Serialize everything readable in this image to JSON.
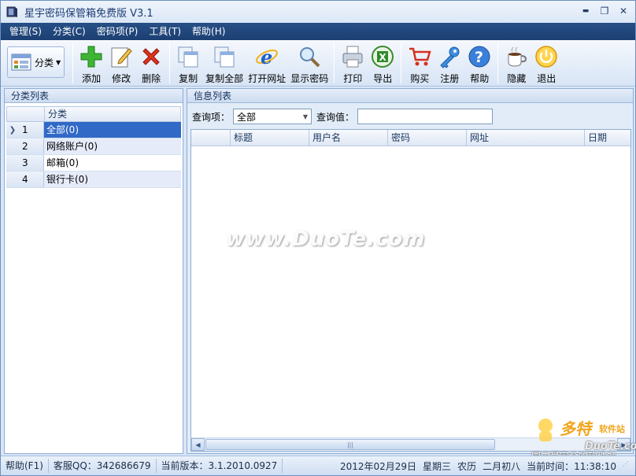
{
  "window": {
    "title": "星宇密码保管箱免费版 V3.1",
    "minimize_label": "▬",
    "maximize_label": "❐",
    "close_label": "✕"
  },
  "menu": [
    {
      "label": "管理(S)"
    },
    {
      "label": "分类(C)"
    },
    {
      "label": "密码项(P)"
    },
    {
      "label": "工具(T)"
    },
    {
      "label": "帮助(H)"
    }
  ],
  "toolbar": {
    "category_label": "分类",
    "buttons": {
      "add": "添加",
      "edit": "修改",
      "delete": "删除",
      "copy": "复制",
      "copy_all": "复制全部",
      "open_url": "打开网址",
      "show_password": "显示密码",
      "print": "打印",
      "export": "导出",
      "buy": "购买",
      "register": "注册",
      "help": "帮助",
      "hide": "隐藏",
      "exit": "退出"
    }
  },
  "left_panel": {
    "title": "分类列表",
    "column": "分类",
    "rows": [
      {
        "num": "1",
        "name": "全部(0)"
      },
      {
        "num": "2",
        "name": "网络账户(0)"
      },
      {
        "num": "3",
        "name": "邮箱(0)"
      },
      {
        "num": "4",
        "name": "银行卡(0)"
      }
    ]
  },
  "right_panel": {
    "title": "信息列表",
    "query_item_label": "查询项：",
    "query_item_value": "全部",
    "query_value_label": "查询值：",
    "query_value": "",
    "columns": [
      "标题",
      "用户名",
      "密码",
      "网址",
      "日期"
    ]
  },
  "watermark": {
    "text": "www.DuoTe.com",
    "corner_main": "多特",
    "corner_sub": "软件站",
    "corner_url": "DuoTe.com",
    "corner_line": "国内最安全的软件站"
  },
  "statusbar": {
    "help": "帮助(F1)",
    "qq": "客服QQ：342686679",
    "version": "当前版本：3.1.2010.0927",
    "date": "2012年02月29日",
    "weekday": "星期三",
    "lunar": "农历",
    "lunar_date": "二月初八",
    "time": "当前时间：11:38:10"
  },
  "colors": {
    "menubar": "#1c3f72",
    "selection": "#3169c6",
    "watermark_orange": "#f1a51c"
  }
}
